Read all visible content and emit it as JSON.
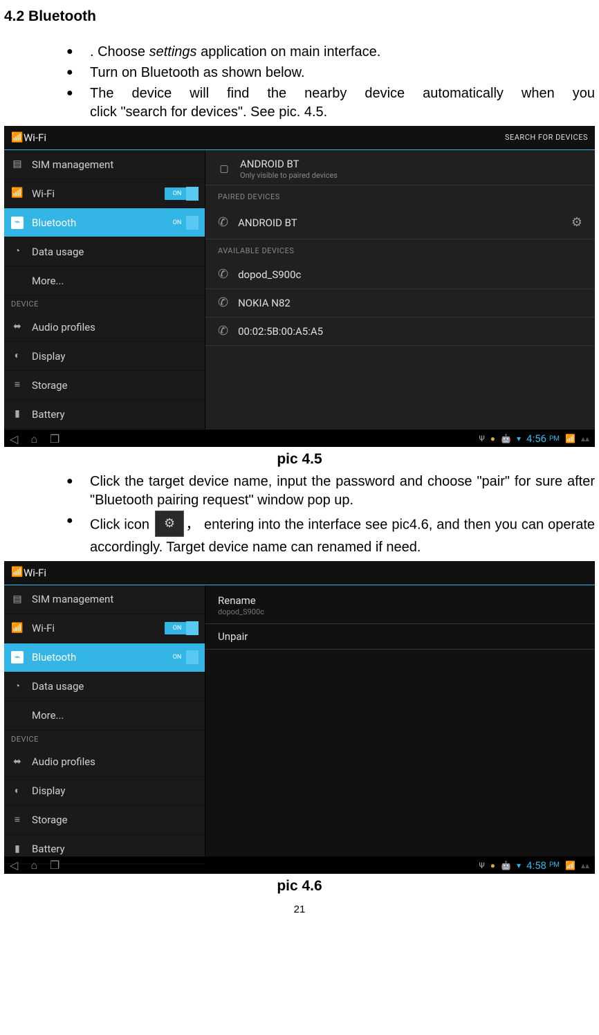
{
  "doc": {
    "section_title": "4.2 Bluetooth",
    "bullets_top": [
      {
        "pre": ". Choose ",
        "em": "settings",
        "post": " application on main interface."
      },
      {
        "text": "  Turn on Bluetooth as shown below."
      },
      {
        "line1": "  The device will find the nearby device automatically when you",
        "line2": "click \"search for devices\". See pic. 4.5."
      }
    ],
    "caption1": "pic 4.5",
    "bullets_mid": [
      {
        "text": "Click the target device name, input the password and choose \"pair\" for sure after \"Bluetooth pairing request\" window pop up."
      },
      {
        "pre": "Click icon ",
        "post": "， entering into the interface see pic4.6, and then you can operate accordingly. Target device name can renamed if need."
      }
    ],
    "caption2": "pic 4.6",
    "page": "21"
  },
  "shot1": {
    "title": "Wi-Fi",
    "search": "SEARCH FOR DEVICES",
    "sidebar": {
      "items": [
        {
          "label": "SIM management",
          "icon": "📶"
        },
        {
          "label": "Wi-Fi",
          "icon": "📶",
          "toggle": "ON"
        },
        {
          "label": "Bluetooth",
          "icon": "B",
          "toggle": "ON",
          "selected": true,
          "bt": true
        },
        {
          "label": "Data usage",
          "icon": "◔"
        },
        {
          "label": "More...",
          "icon": ""
        }
      ],
      "header": "DEVICE",
      "items2": [
        {
          "label": "Audio profiles",
          "icon": "⬌"
        },
        {
          "label": "Display",
          "icon": "◐"
        },
        {
          "label": "Storage",
          "icon": "≡"
        },
        {
          "label": "Battery",
          "icon": "▮"
        }
      ]
    },
    "right": {
      "self": {
        "name": "ANDROID BT",
        "sub": "Only visible to paired devices"
      },
      "h1": "PAIRED DEVICES",
      "paired": [
        {
          "name": "ANDROID BT"
        }
      ],
      "h2": "AVAILABLE DEVICES",
      "avail": [
        {
          "name": "dopod_S900c"
        },
        {
          "name": "NOKIA N82"
        },
        {
          "name": "00:02:5B:00:A5:A5"
        }
      ]
    },
    "clock": "4:56",
    "pm": "PM"
  },
  "shot2": {
    "title": "Wi-Fi",
    "sidebar": {
      "items": [
        {
          "label": "SIM management",
          "icon": "📶"
        },
        {
          "label": "Wi-Fi",
          "icon": "📶",
          "toggle": "ON"
        },
        {
          "label": "Bluetooth",
          "icon": "B",
          "toggle": "ON",
          "selected": true,
          "bt": true
        },
        {
          "label": "Data usage",
          "icon": "◔"
        },
        {
          "label": "More...",
          "icon": ""
        }
      ],
      "header": "DEVICE",
      "items2": [
        {
          "label": "Audio profiles",
          "icon": "⬌"
        },
        {
          "label": "Display",
          "icon": "◐"
        },
        {
          "label": "Storage",
          "icon": "≡"
        },
        {
          "label": "Battery",
          "icon": "▮"
        }
      ]
    },
    "right": {
      "opt1": {
        "t1": "Rename",
        "t2": "dopod_S900c"
      },
      "opt2": {
        "t1": "Unpair"
      }
    },
    "clock": "4:58",
    "pm": "PM"
  }
}
